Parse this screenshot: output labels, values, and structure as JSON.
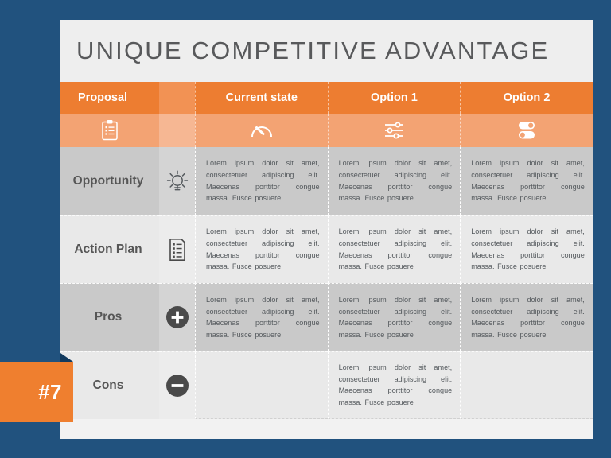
{
  "slide": {
    "background_color": "#21527e",
    "card_color": "#f2f2f2",
    "accent_color": "#ed7d31",
    "accent_light_color": "#f3a373"
  },
  "title": "UNIQUE COMPETITIVE ADVANTAGE",
  "badge": {
    "number": "#7"
  },
  "table": {
    "header": [
      {
        "label": "Proposal",
        "icon": "clipboard-checklist-icon"
      },
      {
        "label": "Current state",
        "icon": "gauge-icon"
      },
      {
        "label": "Option 1",
        "icon": "sliders-icon"
      },
      {
        "label": "Option 2",
        "icon": "toggles-icon"
      }
    ],
    "body_text": "Lorem ipsum dolor sit amet, consectetuer adipiscing elit. Maecenas porttitor congue massa. Fusce posuere",
    "rows": [
      {
        "label": "Opportunity",
        "icon": "lightbulb-icon",
        "shade": "dark",
        "cells": [
          "Lorem ipsum dolor sit amet, consectetuer adipiscing elit. Maecenas porttitor congue massa. Fusce posuere",
          "Lorem ipsum dolor sit amet, consectetuer adipiscing elit. Maecenas porttitor congue massa. Fusce posuere",
          "Lorem ipsum dolor sit amet, consectetuer adipiscing elit. Maecenas porttitor congue massa. Fusce posuere"
        ]
      },
      {
        "label": "Action Plan",
        "icon": "checklist-document-icon",
        "shade": "light",
        "cells": [
          "Lorem ipsum dolor sit amet, consectetuer adipiscing elit. Maecenas porttitor congue massa. Fusce posuere",
          "Lorem ipsum dolor sit amet, consectetuer adipiscing elit. Maecenas porttitor congue massa. Fusce posuere",
          "Lorem ipsum dolor sit amet, consectetuer adipiscing elit. Maecenas porttitor congue massa. Fusce posuere"
        ]
      },
      {
        "label": "Pros",
        "icon": "plus-circle-icon",
        "shade": "dark",
        "cells": [
          "Lorem ipsum dolor sit amet, consectetuer adipiscing elit. Maecenas porttitor congue massa. Fusce posuere",
          "Lorem ipsum dolor sit amet, consectetuer adipiscing elit. Maecenas porttitor congue massa. Fusce posuere",
          "Lorem ipsum dolor sit amet, consectetuer adipiscing elit. Maecenas porttitor congue massa. Fusce posuere"
        ]
      },
      {
        "label": "Cons",
        "icon": "minus-circle-icon",
        "shade": "light",
        "cells": [
          "",
          "Lorem ipsum dolor sit amet, consectetuer adipiscing elit. Maecenas porttitor congue massa. Fusce posuere",
          ""
        ]
      }
    ]
  }
}
